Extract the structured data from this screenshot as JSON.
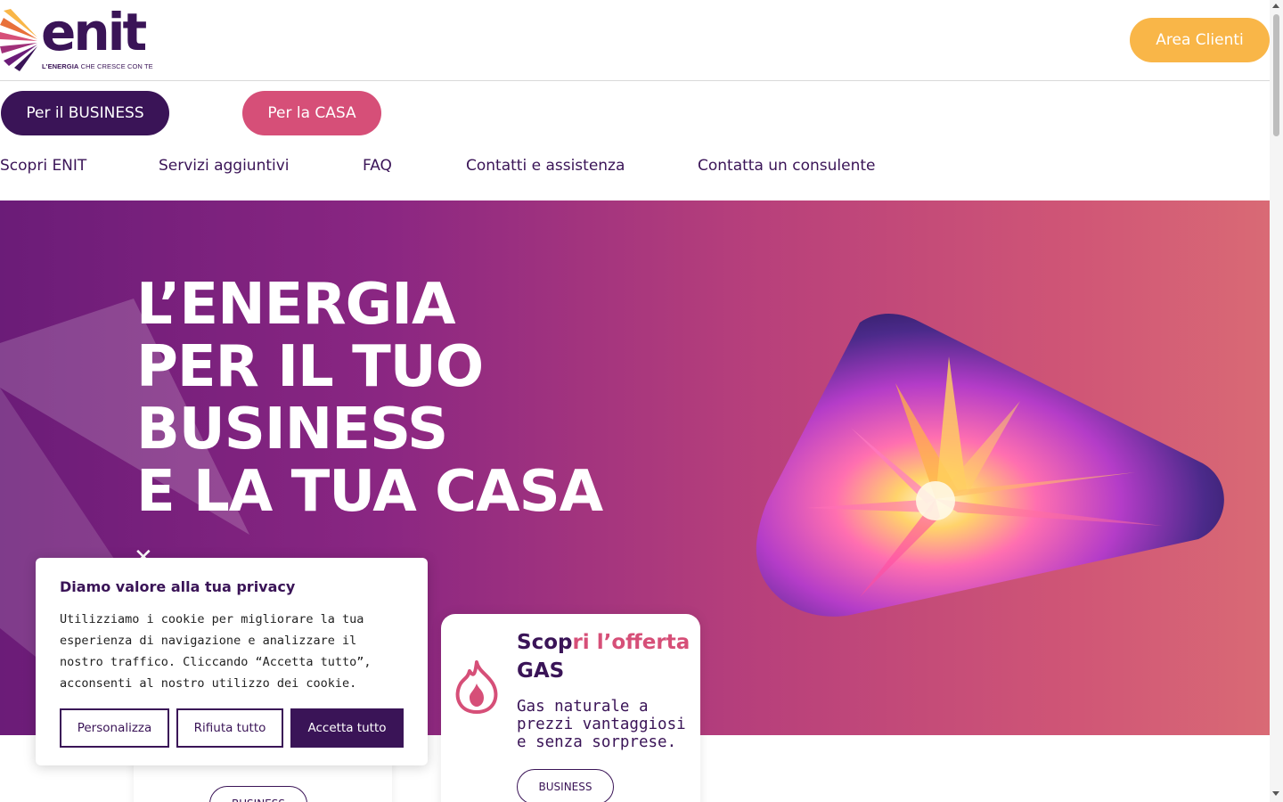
{
  "header": {
    "logo_word": "enit",
    "logo_tagline_bold": "L'ENERGIA",
    "logo_tagline_rest": " CHE CRESCE CON TE",
    "area_clienti_label": "Area Clienti"
  },
  "segments": {
    "business_label": "Per il BUSINESS",
    "casa_label": "Per la CASA"
  },
  "nav": {
    "items": [
      {
        "label": "Scopri ENIT"
      },
      {
        "label": "Servizi aggiuntivi"
      },
      {
        "label": "FAQ"
      },
      {
        "label": "Contatti e assistenza"
      },
      {
        "label": "Contatta un consulente"
      }
    ]
  },
  "hero": {
    "title_lines": [
      "L’ENERGIA",
      "PER IL TUO",
      "BUSINESS",
      "E LA TUA CASA"
    ],
    "close_symbol": "✕"
  },
  "cookie": {
    "title": "Diamo valore alla tua privacy",
    "text": "Utilizziamo i cookie per migliorare la tua esperienza di navigazione e analizzare il nostro traffico. Cliccando “Accetta tutto”, acconsenti al nostro utilizzo dei cookie.",
    "customize_label": "Personalizza",
    "reject_label": "Rifiuta tutto",
    "accept_label": "Accetta tutto"
  },
  "offer_card": {
    "title_part1": "Scop",
    "title_part2": "ri l’offerta",
    "title_part3": "GAS",
    "description": "Gas naturale a prezzi vantaggiosi e senza sorprese.",
    "button_label": "BUSINESS",
    "icon": "flame-icon"
  },
  "back_card": {
    "button_label": "BUSINESS"
  },
  "colors": {
    "primary": "#3a1457",
    "pink": "#d64f78",
    "orange": "#f9b648"
  }
}
